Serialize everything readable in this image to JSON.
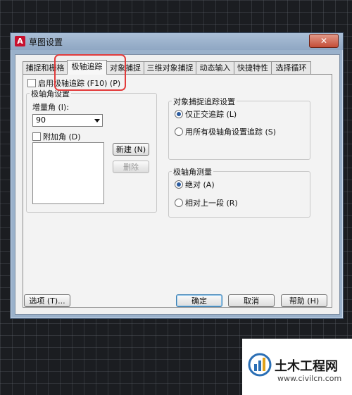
{
  "window": {
    "title": "草图设置",
    "close_glyph": "✕",
    "app_icon": "A"
  },
  "tabs": [
    {
      "label": "捕捉和栅格",
      "active": false
    },
    {
      "label": "极轴追踪",
      "active": true
    },
    {
      "label": "对象捕捉",
      "active": false
    },
    {
      "label": "三维对象捕捉",
      "active": false
    },
    {
      "label": "动态输入",
      "active": false
    },
    {
      "label": "快捷特性",
      "active": false
    },
    {
      "label": "选择循环",
      "active": false
    }
  ],
  "polar": {
    "enable_label": "启用极轴追踪 (F10) (P)",
    "enable_checked": false,
    "angle_group_title": "极轴角设置",
    "increment_label": "增量角 (I):",
    "increment_value": "90",
    "additional_label": "附加角 (D)",
    "additional_checked": false,
    "new_button": "新建 (N)",
    "delete_button": "删除"
  },
  "snap_tracking": {
    "group_title": "对象捕捉追踪设置",
    "options": [
      {
        "label": "仅正交追踪 (L)",
        "checked": true
      },
      {
        "label": "用所有极轴角设置追踪 (S)",
        "checked": false
      }
    ]
  },
  "measurement": {
    "group_title": "极轴角测量",
    "options": [
      {
        "label": "绝对 (A)",
        "checked": true
      },
      {
        "label": "相对上一段 (R)",
        "checked": false
      }
    ]
  },
  "footer": {
    "options_button": "选项 (T)...",
    "ok_button": "确定",
    "cancel_button": "取消",
    "help_button": "帮助 (H)"
  },
  "watermark": {
    "title": "土木工程网",
    "url": "www.civilcn.com"
  },
  "colors": {
    "highlight": "#e23b3b",
    "titlebar": "#9ab1cb",
    "panel": "#f3f3f3"
  }
}
